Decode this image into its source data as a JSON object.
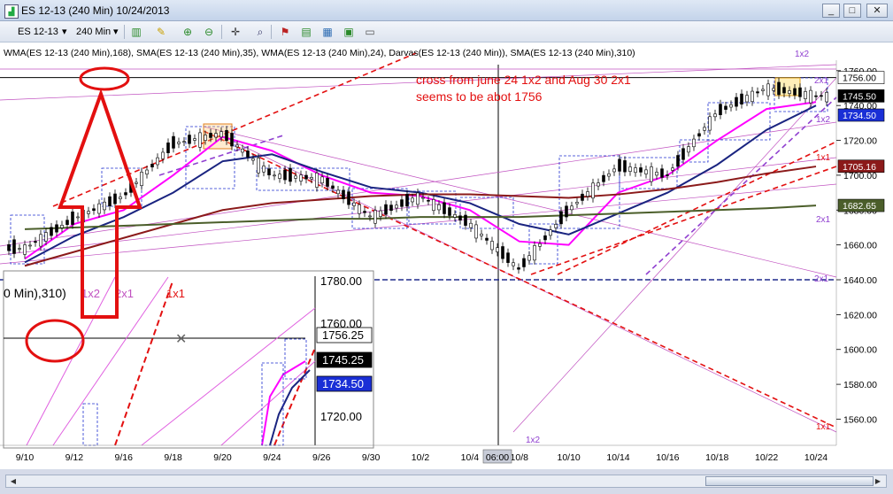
{
  "window": {
    "title": "ES 12-13 (240 Min)  10/24/2013",
    "app_icon": "chart-icon",
    "buttons": {
      "minimize": "_",
      "maximize": "□",
      "close": "✕"
    }
  },
  "toolbar": {
    "instrument": "ES 12-13",
    "interval": "240 Min",
    "dropdown_glyph": "▾",
    "icons": [
      "bar-style-icon",
      "draw-pencil-icon",
      "zoom-in-icon",
      "zoom-out-icon",
      "crosshair-icon",
      "magnifier-icon",
      "strategy-icon",
      "indicator-icon",
      "chart-properties-icon",
      "data-box-icon",
      "export-icon"
    ]
  },
  "chart_data": {
    "type": "line",
    "indicator_label": "WMA(ES 12-13 (240 Min),168), SMA(ES 12-13 (240 Min),35), WMA(ES 12-13 (240 Min),24), Darvas(ES 12-13 (240 Min)), SMA(ES 12-13 (240 Min),310)",
    "annotation": [
      "cross from june 24 1x2 and Aug 30 2x1",
      "seems to be abot 1756"
    ],
    "x_tick_labels": [
      "9/10",
      "9/12",
      "9/16",
      "9/18",
      "9/20",
      "9/24",
      "9/26",
      "9/30",
      "10/2",
      "10/4",
      "10/8",
      "10/10",
      "10/14",
      "10/16",
      "10/18",
      "10/22",
      "10/24"
    ],
    "crosshair_time_label": "06:00",
    "y_tick_labels": [
      "1760.00",
      "1740.00",
      "1720.00",
      "1700.00",
      "1680.00",
      "1660.00",
      "1640.00",
      "1620.00",
      "1600.00",
      "1580.00",
      "1560.00"
    ],
    "ylim": [
      1545,
      1766
    ],
    "price_tags": [
      {
        "label": "1756.00",
        "value": 1756,
        "bg": "#ffffff",
        "fg": "#000000"
      },
      {
        "label": "1745.50",
        "value": 1745.5,
        "bg": "#000000",
        "fg": "#ffffff"
      },
      {
        "label": "1734.50",
        "value": 1734.5,
        "bg": "#1a2fd6",
        "fg": "#ffffff"
      },
      {
        "label": "1705.16",
        "value": 1705.16,
        "bg": "#8b1a1a",
        "fg": "#ffffff"
      },
      {
        "label": "1682.65",
        "value": 1682.65,
        "bg": "#4b5e2a",
        "fg": "#ffffff"
      }
    ],
    "fan_labels": [
      "1x2",
      "2x1",
      "1x2",
      "1x1",
      "2x1",
      "2x1",
      "1x1",
      "1x2"
    ],
    "horizontal_lines": [
      {
        "value": 1756,
        "style": "solid",
        "color": "#000000"
      },
      {
        "value": 1640,
        "style": "dashed",
        "color": "#1f2a8c"
      }
    ],
    "series": [
      {
        "name": "WMA 24",
        "color": "#ff00ff",
        "x": [
          "9/10",
          "9/12",
          "9/16",
          "9/18",
          "9/20",
          "9/24",
          "9/26",
          "9/30",
          "10/2",
          "10/4",
          "10/8",
          "10/10",
          "10/14",
          "10/16",
          "10/18",
          "10/22",
          "10/24"
        ],
        "values": [
          1652,
          1672,
          1680,
          1700,
          1722,
          1714,
          1700,
          1690,
          1688,
          1680,
          1662,
          1660,
          1690,
          1700,
          1720,
          1738,
          1742
        ]
      },
      {
        "name": "SMA 35",
        "color": "#1a2480",
        "x": [
          "9/10",
          "9/12",
          "9/16",
          "9/18",
          "9/20",
          "9/24",
          "9/26",
          "9/30",
          "10/2",
          "10/4",
          "10/8",
          "10/10",
          "10/14",
          "10/16",
          "10/18",
          "10/22",
          "10/24"
        ],
        "values": [
          1650,
          1665,
          1676,
          1690,
          1708,
          1712,
          1702,
          1693,
          1690,
          1684,
          1672,
          1666,
          1678,
          1690,
          1706,
          1726,
          1740
        ]
      },
      {
        "name": "WMA 168",
        "color": "#8b1a1a",
        "x": [
          "9/10",
          "9/12",
          "9/16",
          "9/18",
          "9/20",
          "9/24",
          "9/26",
          "9/30",
          "10/2",
          "10/4",
          "10/8",
          "10/10",
          "10/14",
          "10/16",
          "10/18",
          "10/22",
          "10/24"
        ],
        "values": [
          1648,
          1656,
          1664,
          1672,
          1680,
          1684,
          1686,
          1688,
          1689,
          1689,
          1688,
          1687,
          1689,
          1692,
          1696,
          1701,
          1705
        ]
      },
      {
        "name": "SMA 310",
        "color": "#4b5e2a",
        "x": [
          "9/10",
          "9/12",
          "9/16",
          "9/18",
          "9/20",
          "9/24",
          "9/26",
          "9/30",
          "10/2",
          "10/4",
          "10/8",
          "10/10",
          "10/14",
          "10/16",
          "10/18",
          "10/22",
          "10/24"
        ],
        "values": [
          1669,
          1670,
          1671,
          1672,
          1673,
          1674,
          1675,
          1675,
          1676,
          1676,
          1676,
          1677,
          1678,
          1679,
          1680,
          1681,
          1682.6
        ]
      },
      {
        "name": "Price",
        "color": "#000000",
        "x": [
          "9/10",
          "9/12",
          "9/16",
          "9/18",
          "9/20",
          "9/24",
          "9/26",
          "9/30",
          "10/2",
          "10/4",
          "10/8",
          "10/10",
          "10/14",
          "10/16",
          "10/18",
          "10/22",
          "10/24"
        ],
        "values": [
          1658,
          1675,
          1688,
          1718,
          1724,
          1700,
          1698,
          1676,
          1688,
          1672,
          1646,
          1680,
          1705,
          1700,
          1736,
          1750,
          1745.5
        ]
      }
    ]
  },
  "inset": {
    "y_tick_labels": [
      "1780.00",
      "1760.00",
      "1720.00"
    ],
    "price_tags": [
      "1756.25",
      "1745.25",
      "1734.50"
    ],
    "label_fragment": "0 Min),310)",
    "fan_labels": [
      "1x2",
      "2x1",
      "1x1"
    ]
  }
}
